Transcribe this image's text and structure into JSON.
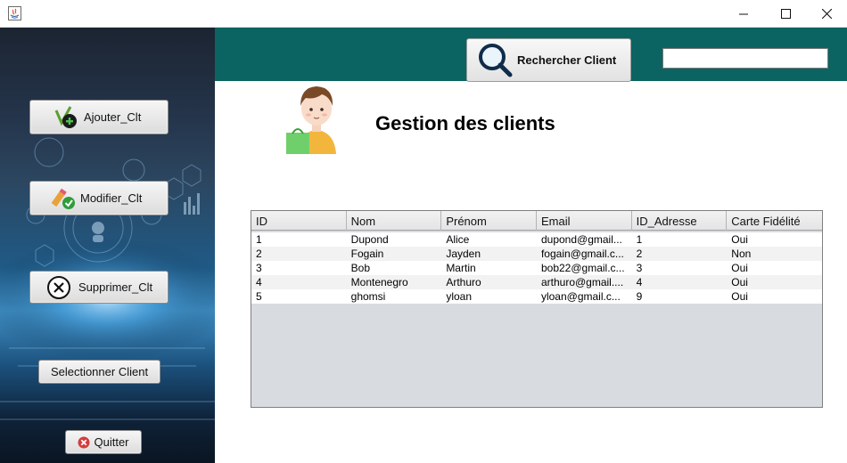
{
  "colors": {
    "header": "#0b6461",
    "sidebar_dark": "#1c2431",
    "sidebar_glow": "#3f8fc4",
    "quit_icon": "#d43c3c",
    "check_green": "#2e9d3a"
  },
  "sidebar": {
    "add_button": {
      "label": "Ajouter_Clt",
      "icon": "add-client-icon"
    },
    "edit_button": {
      "label": "Modifier_Clt",
      "icon": "edit-client-icon"
    },
    "delete_button": {
      "label": "Supprimer_Clt",
      "icon": "delete-client-icon"
    },
    "select_button": {
      "label": "Selectionner Client"
    },
    "quit_button": {
      "label": "Quitter",
      "icon": "quit-icon"
    }
  },
  "header": {
    "search_button": {
      "label": "Rechercher Client",
      "icon": "magnifier-icon"
    },
    "search_input": {
      "value": "",
      "placeholder": ""
    }
  },
  "main": {
    "title": "Gestion des clients",
    "table": {
      "columns": [
        "ID",
        "Nom",
        "Prénom",
        "Email",
        "ID_Adresse",
        "Carte Fidélité"
      ],
      "rows": [
        [
          "1",
          "Dupond",
          "Alice",
          "dupond@gmail...",
          "1",
          "Oui"
        ],
        [
          "2",
          "Fogain",
          "Jayden",
          "fogain@gmail.c...",
          "2",
          "Non"
        ],
        [
          "3",
          "Bob",
          "Martin",
          "bob22@gmail.c...",
          "3",
          "Oui"
        ],
        [
          "4",
          "Montenegro",
          "Arthuro",
          "arthuro@gmail....",
          "4",
          "Oui"
        ],
        [
          "5",
          "ghomsi",
          "yloan",
          "yloan@gmail.c...",
          "9",
          "Oui"
        ]
      ]
    }
  }
}
